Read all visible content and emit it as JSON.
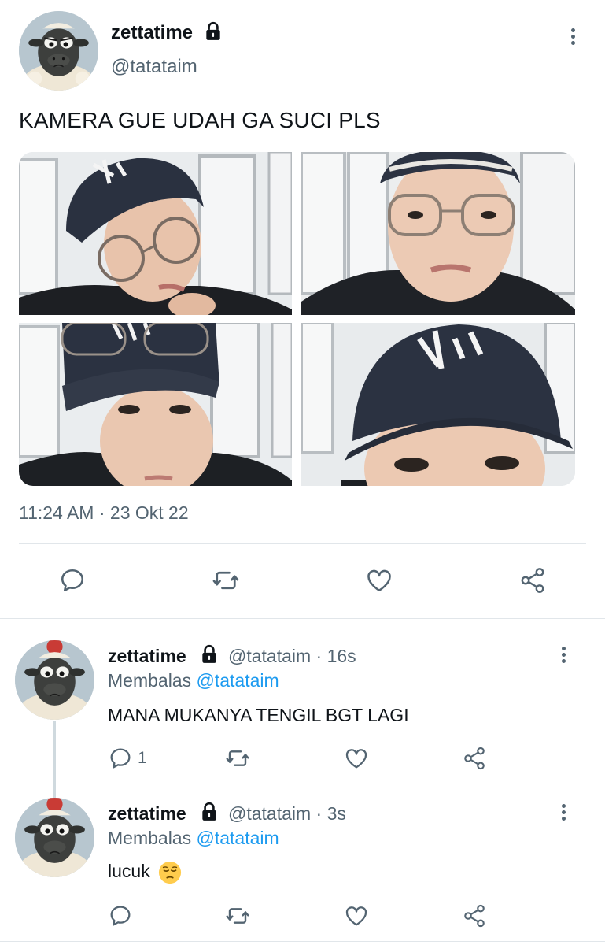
{
  "main_tweet": {
    "display_name": "zettatime",
    "handle": "@tatataim",
    "text": "KAMERA GUE UDAH GA SUCI PLS",
    "timestamp": "11:24 AM · 23 Okt 22",
    "media": [
      {
        "description": "selfie-winking-glasses-cap"
      },
      {
        "description": "selfie-glasses-front"
      },
      {
        "description": "selfie-cap-glasses-on-cap"
      },
      {
        "description": "selfie-cap-closeup"
      }
    ]
  },
  "replies": [
    {
      "display_name": "zettatime",
      "meta": "@tatataim · 16s",
      "replying_label": "Membalas",
      "replying_handle": "@tatataim",
      "text": "MANA MUKANYA TENGIL BGT LAGI",
      "reply_count": "1"
    },
    {
      "display_name": "zettatime",
      "meta": "@tatataim · 3s",
      "replying_label": "Membalas",
      "replying_handle": "@tatataim",
      "text": "lucuk",
      "emoji": "pensive-face-emoji",
      "reply_count": ""
    }
  ],
  "colors": {
    "text": "#0f1419",
    "secondary": "#536471",
    "link": "#1d9bf0",
    "divider": "#e1e6ea"
  },
  "icons": [
    "lock-icon",
    "more-icon",
    "reply-icon",
    "retweet-icon",
    "like-icon",
    "share-icon"
  ]
}
